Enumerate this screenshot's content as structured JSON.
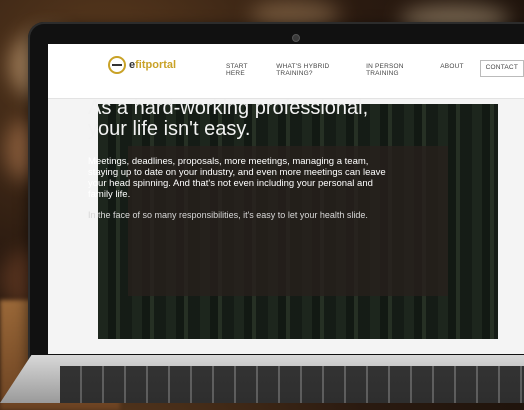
{
  "brand": {
    "logo_prefix": "e",
    "logo_name": "fitportal"
  },
  "nav": {
    "items": [
      "START HERE",
      "WHAT'S HYBRID TRAINING?",
      "IN PERSON TRAINING",
      "ABOUT",
      "CONTACT"
    ]
  },
  "hero": {
    "headline": "As a hard-working professional, your life isn't easy.",
    "body": "Meetings, deadlines, proposals, more meetings, managing a team, staying up to date on your industry, and even more meetings can leave your head spinning. And that's not even including your personal and family life.",
    "subtext": "In the face of so many responsibilities, it's easy to let your health slide."
  },
  "colors": {
    "accent": "#c9a227",
    "header_bg": "#ffffff",
    "card_bg": "#28201c"
  }
}
